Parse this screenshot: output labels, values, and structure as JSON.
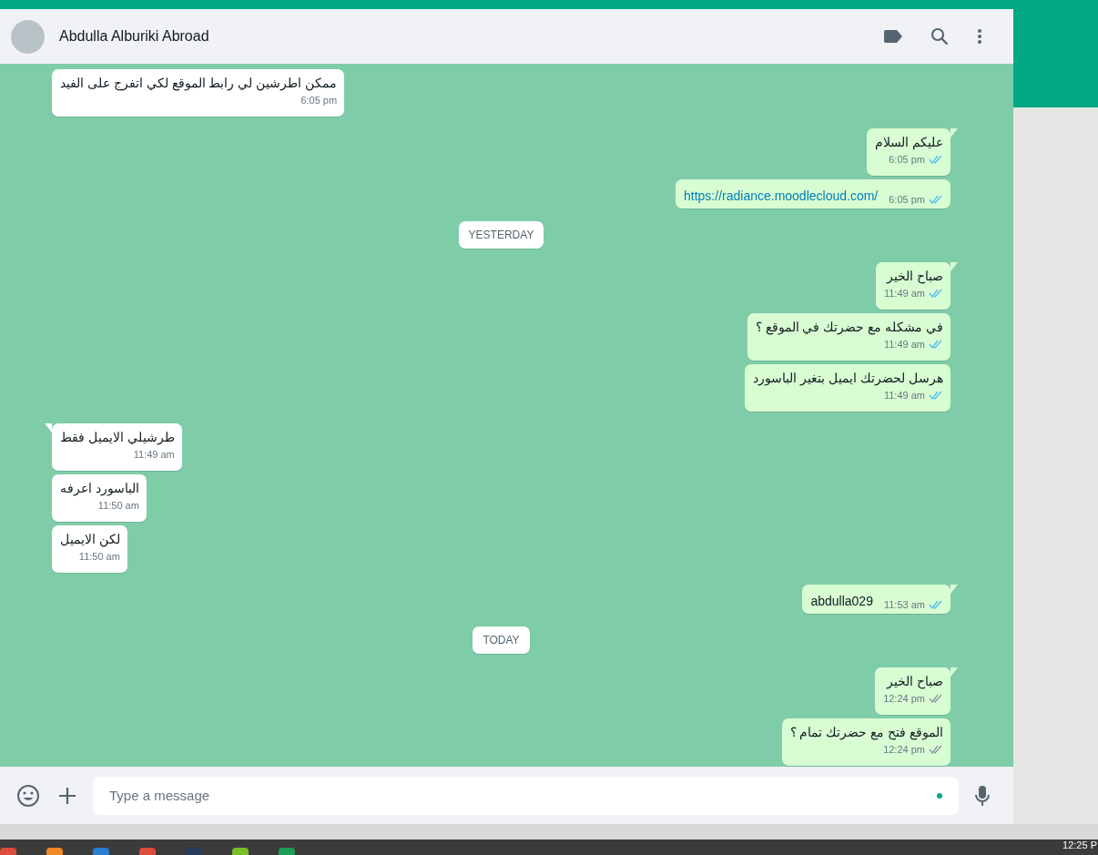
{
  "header": {
    "contact_name": "Abdulla Alburiki Abroad"
  },
  "messages": [
    {
      "kind": "in",
      "text": "ممكن اطرشين لي رابط الموقع لكي اتفرج على الفيد",
      "time": "6:05 pm",
      "tail": false,
      "inline_time": false
    },
    {
      "kind": "out",
      "text": "عليكم السلام",
      "time": "6:05 pm",
      "tail": true,
      "inline_time": false,
      "read": true
    },
    {
      "kind": "out",
      "text": "https://radiance.moodlecloud.com/",
      "link": true,
      "time": "6:05 pm",
      "tail": false,
      "inline_time": true,
      "read": true
    },
    {
      "kind": "date",
      "text": "YESTERDAY"
    },
    {
      "kind": "out",
      "text": "صباح الخير",
      "time": "11:49 am",
      "tail": true,
      "inline_time": false,
      "read": true
    },
    {
      "kind": "out",
      "text": "في مشكله مع حضرتك في الموقع ؟",
      "time": "11:49 am",
      "tail": false,
      "inline_time": false,
      "read": true
    },
    {
      "kind": "out",
      "text": "هرسل لحضرتك ايميل بتغير الباسورد",
      "time": "11:49 am",
      "tail": false,
      "inline_time": false,
      "read": true
    },
    {
      "kind": "in",
      "text": "طرشيلي الايميل فقط",
      "time": "11:49 am",
      "tail": true,
      "inline_time": false
    },
    {
      "kind": "in",
      "text": "الباسورد اعرفه",
      "time": "11:50 am",
      "tail": false,
      "inline_time": false
    },
    {
      "kind": "in",
      "text": "لكن الايميل",
      "time": "11:50 am",
      "tail": false,
      "inline_time": false
    },
    {
      "kind": "out",
      "text": "abdulla029",
      "time": "11:53 am",
      "tail": true,
      "inline_time": true,
      "read": true
    },
    {
      "kind": "date",
      "text": "TODAY"
    },
    {
      "kind": "out",
      "text": "صباح الخير",
      "time": "12:24 pm",
      "tail": true,
      "inline_time": false,
      "read": false
    },
    {
      "kind": "out",
      "text": "الموقع فتح مع حضرتك تمام ؟",
      "time": "12:24 pm",
      "tail": false,
      "inline_time": false,
      "read": false
    }
  ],
  "composer": {
    "placeholder": "Type a message"
  },
  "taskbar": {
    "clock": "12:25 P"
  }
}
